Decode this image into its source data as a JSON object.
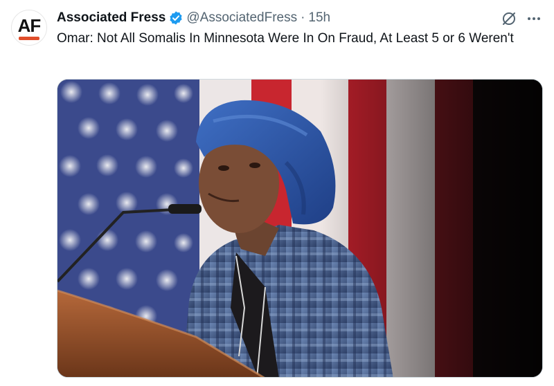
{
  "account": {
    "avatar_text": "AF",
    "name": "Associated Fress",
    "handle": "@AssociatedFress",
    "separator": "·",
    "time": "15h",
    "verified": true
  },
  "tweet": {
    "text": "Omar: Not All Somalis In Minnesota Were In On Fraud, At Least 5 or 6 Weren't"
  },
  "media": {
    "type": "photo"
  },
  "icons": [
    "verified-badge-icon",
    "grok-icon",
    "more-options-icon"
  ],
  "colors": {
    "verified": "#1d9bf0",
    "secondary_text": "#536471",
    "logo_accent": "#e04e2b"
  }
}
